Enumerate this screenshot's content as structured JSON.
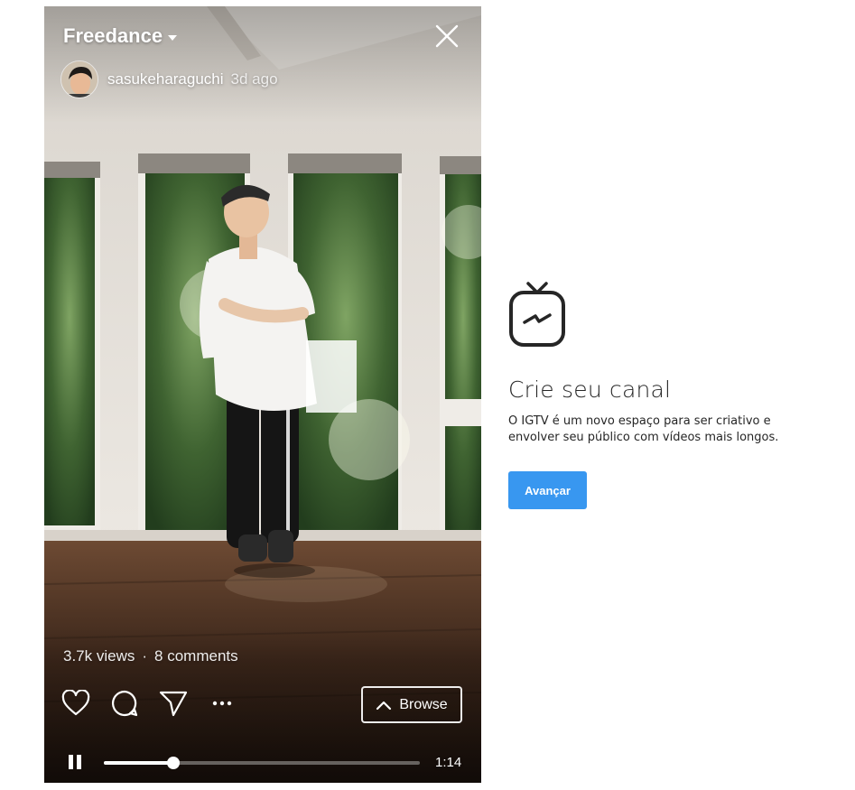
{
  "player": {
    "channel_title": "Freedance",
    "author": {
      "username": "sasukeharaguchi",
      "posted": "3d ago"
    },
    "stats": {
      "views": "3.7k views",
      "separator": "·",
      "comments": "8 comments"
    },
    "actions": {
      "like_icon": "heart-icon",
      "comment_icon": "comment-icon",
      "share_icon": "paper-plane-icon",
      "more_icon": "more-icon",
      "browse_label": "Browse",
      "browse_icon": "chevron-up-icon"
    },
    "playback": {
      "state_icon": "pause-icon",
      "progress": 0.22,
      "duration": "1:14"
    }
  },
  "promo": {
    "logo_icon": "igtv-logo-icon",
    "title": "Crie seu canal",
    "description": "O IGTV é um novo espaço para ser criativo e envolver seu público com vídeos mais longos.",
    "button_label": "Avançar",
    "button_color": "#3897f0"
  }
}
